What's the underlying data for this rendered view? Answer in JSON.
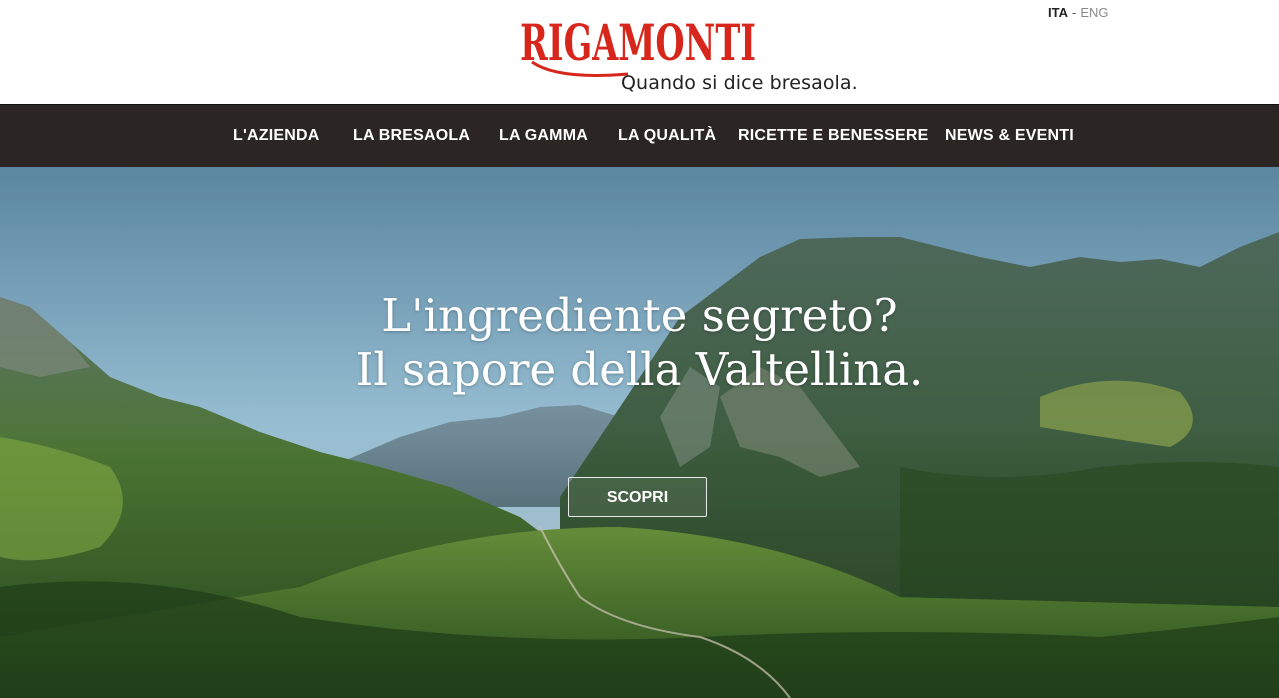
{
  "header": {
    "logo_text": "RIGAMONTI",
    "tagline": "Quando si dice bresaola.",
    "lang_active": "ITA",
    "lang_separator": "-",
    "lang_other": "ENG"
  },
  "nav": {
    "items": [
      {
        "label": "L'AZIENDA"
      },
      {
        "label": "LA BRESAOLA"
      },
      {
        "label": "LA GAMMA"
      },
      {
        "label": "LA QUALITÀ"
      },
      {
        "label": "RICETTE E BENESSERE"
      },
      {
        "label": "NEWS & EVENTI"
      }
    ]
  },
  "hero": {
    "line1": "L'ingrediente segreto?",
    "line2": "Il sapore della Valtellina.",
    "cta_label": "SCOPRI"
  },
  "colors": {
    "brand_red": "#d7261c",
    "nav_bg": "#2b2623",
    "sky": "#7fb2cd",
    "mountain_green": "#3f6a2b"
  }
}
